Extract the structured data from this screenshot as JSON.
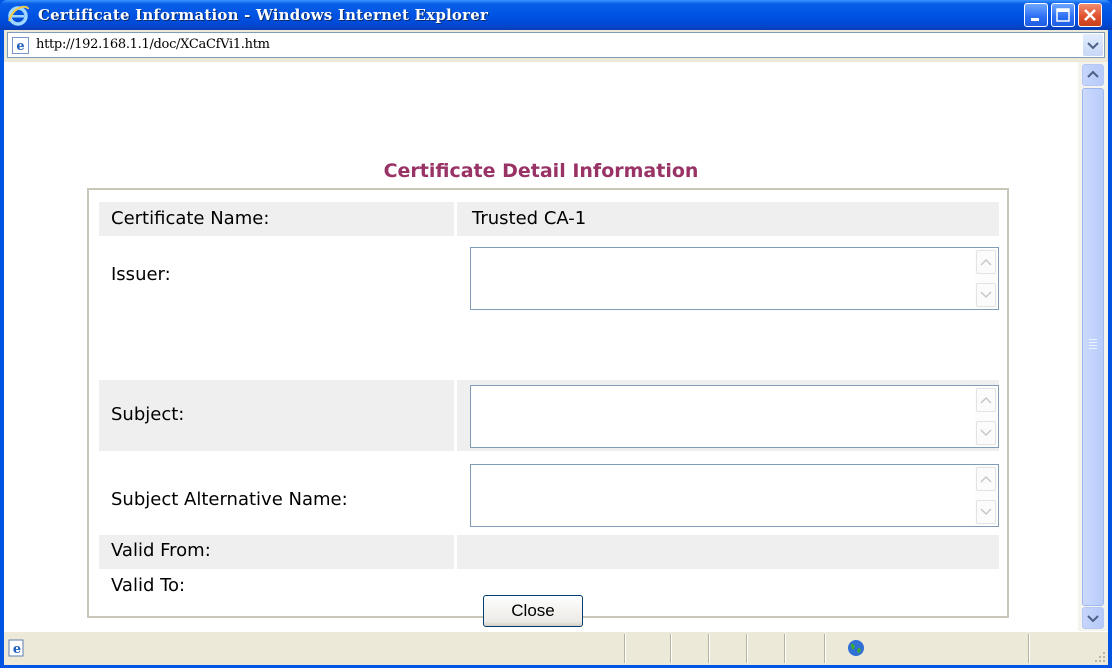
{
  "window": {
    "title": "Certificate Information - Windows Internet Explorer"
  },
  "address": {
    "url": "http://192.168.1.1/doc/XCaCfVi1.htm"
  },
  "page": {
    "heading": "Certificate Detail Information",
    "fields": {
      "certificate_name_label": "Certificate Name:",
      "certificate_name_value": "Trusted CA-1",
      "issuer_label": "Issuer:",
      "issuer_value": "",
      "subject_label": "Subject:",
      "subject_value": "",
      "subject_alt_label": "Subject Alternative Name:",
      "subject_alt_value": "",
      "valid_from_label": "Valid From:",
      "valid_from_value": "",
      "valid_to_label": "Valid To:",
      "valid_to_value": ""
    },
    "close_label": "Close"
  },
  "colors": {
    "heading": "#993366",
    "row_shade": "#efefef",
    "titlebar": "#0055e5"
  }
}
